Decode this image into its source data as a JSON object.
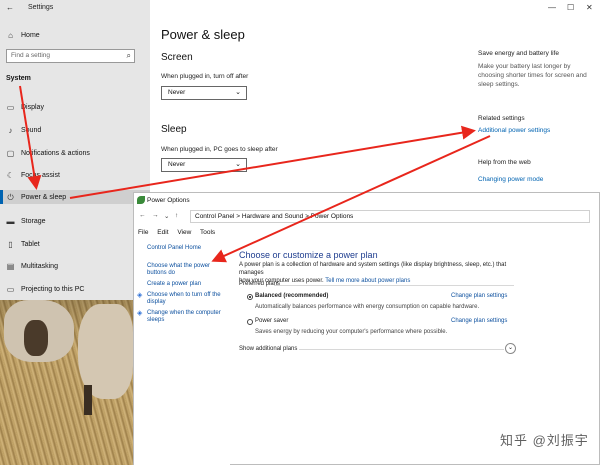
{
  "settings": {
    "title": "Settings",
    "home": "Home",
    "search_placeholder": "Find a setting",
    "section": "System",
    "nav": [
      {
        "label": "Display",
        "icon": "display-icon"
      },
      {
        "label": "Sound",
        "icon": "sound-icon"
      },
      {
        "label": "Notifications & actions",
        "icon": "notifications-icon"
      },
      {
        "label": "Focus assist",
        "icon": "focus-assist-icon"
      },
      {
        "label": "Power & sleep",
        "icon": "power-icon"
      },
      {
        "label": "Storage",
        "icon": "storage-icon"
      },
      {
        "label": "Tablet",
        "icon": "tablet-icon"
      },
      {
        "label": "Multitasking",
        "icon": "multitasking-icon"
      },
      {
        "label": "Projecting to this PC",
        "icon": "projecting-icon"
      }
    ],
    "selected_index": 4,
    "page_title": "Power & sleep",
    "screen": {
      "heading": "Screen",
      "label": "When plugged in, turn off after",
      "value": "Never"
    },
    "sleep": {
      "heading": "Sleep",
      "label": "When plugged in, PC goes to sleep after",
      "value": "Never"
    },
    "right": {
      "save_heading": "Save energy and battery life",
      "save_desc_1": "Make your battery last longer by",
      "save_desc_2": "choosing shorter times for screen and",
      "save_desc_3": "sleep settings.",
      "related_heading": "Related settings",
      "additional_power": "Additional power settings",
      "help_heading": "Help from the web",
      "changing_power_mode": "Changing power mode"
    },
    "window_controls": {
      "minimize": "—",
      "maximize": "☐",
      "close": "✕"
    }
  },
  "power_options": {
    "title": "Power Options",
    "address": {
      "c1": "Control Panel",
      "sep": ">",
      "c2": "Hardware and Sound",
      "c3": "Power Options"
    },
    "menu": [
      "File",
      "Edit",
      "View",
      "Tools"
    ],
    "left_links": {
      "home": "Control Panel Home",
      "power_buttons_1": "Choose what the power",
      "power_buttons_2": "buttons do",
      "create_plan": "Create a power plan",
      "display_off_1": "Choose when to turn off the",
      "display_off_2": "display",
      "computer_sleeps_1": "Change when the computer",
      "computer_sleeps_2": "sleeps"
    },
    "heading": "Choose or customize a power plan",
    "desc_1": "A power plan is a collection of hardware and system settings (like display brightness, sleep, etc.) that manages",
    "desc_2": "how your computer uses power.",
    "desc_link": "Tell me more about power plans",
    "preferred": "Preferred plans",
    "plans": [
      {
        "name": "Balanced (recommended)",
        "desc": "Automatically balances performance with energy consumption on capable hardware.",
        "link": "Change plan settings",
        "selected": true
      },
      {
        "name": "Power saver",
        "desc": "Saves energy by reducing your computer's performance where possible.",
        "link": "Change plan settings",
        "selected": false
      }
    ],
    "show_additional": "Show additional plans"
  },
  "watermark": "知乎 @刘振宇",
  "colors": {
    "accent": "#0063b1",
    "arrow": "#e8261c",
    "link": "#0b4f9e",
    "heading_blue": "#1e3d8f",
    "sidebar_bg": "#e6e6e6"
  }
}
